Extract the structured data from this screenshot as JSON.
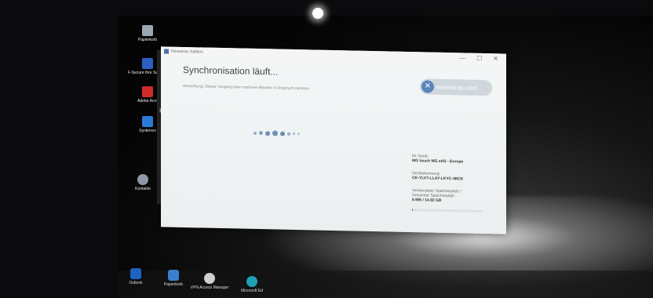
{
  "window": {
    "title": "Novextras Sattlers",
    "minimize_glyph": "—",
    "maximize_glyph": "☐",
    "close_glyph": "✕"
  },
  "main": {
    "heading": "Synchronisation läuft...",
    "note": "Anmerkung: Dieser Vorgang kann mehrere Minuten in Anspruch nehmen"
  },
  "brand": {
    "mark": "✕",
    "name": "novextras.com",
    "color": "#5b84b9"
  },
  "device": {
    "label": "Ihr Gerät:",
    "value": "MG touch MG eHS - Europe"
  },
  "device_id": {
    "label": "Gerätekennung:",
    "value": "CK-YLV7-LLAY-LKYC-4BC6"
  },
  "storage": {
    "label1": "Verwendeter Speicherplatz /",
    "label2": "Gesamter Speicherplatz:",
    "value": "8 MB / 14.92 GB",
    "used_fraction": 0.0005
  },
  "desktop_icons": [
    {
      "label": "Papierkorb",
      "icon": "recycle-bin-icon",
      "color": "#9aa6b2"
    },
    {
      "label": "F-Secure Ihre Security",
      "icon": "shield-icon",
      "color": "#2f5fc4"
    },
    {
      "label": "Adobe Acro",
      "icon": "pdf-icon",
      "color": "#d22b2b"
    },
    {
      "label": "Synterrex",
      "icon": "app-icon",
      "color": "#2b7bd6"
    },
    {
      "label": "Kontakte",
      "icon": "user-icon",
      "color": "#8f98a8"
    }
  ],
  "sidebar_icons": [
    "home-icon",
    "back-icon",
    "menu-icon",
    "cart-icon",
    "logout-icon"
  ],
  "taskbar_icons": [
    {
      "label": "Outlook",
      "icon": "outlook-icon",
      "color": "#1e63c4"
    },
    {
      "label": "Papierkorb",
      "icon": "recycle-bin-icon",
      "color": "#3c7fd0"
    },
    {
      "label": "VPN Access Manager",
      "icon": "vpn-icon",
      "color": "#cfcfcf"
    },
    {
      "label": "Microsoft Ed",
      "icon": "edge-icon",
      "color": "#1da1b4"
    }
  ]
}
